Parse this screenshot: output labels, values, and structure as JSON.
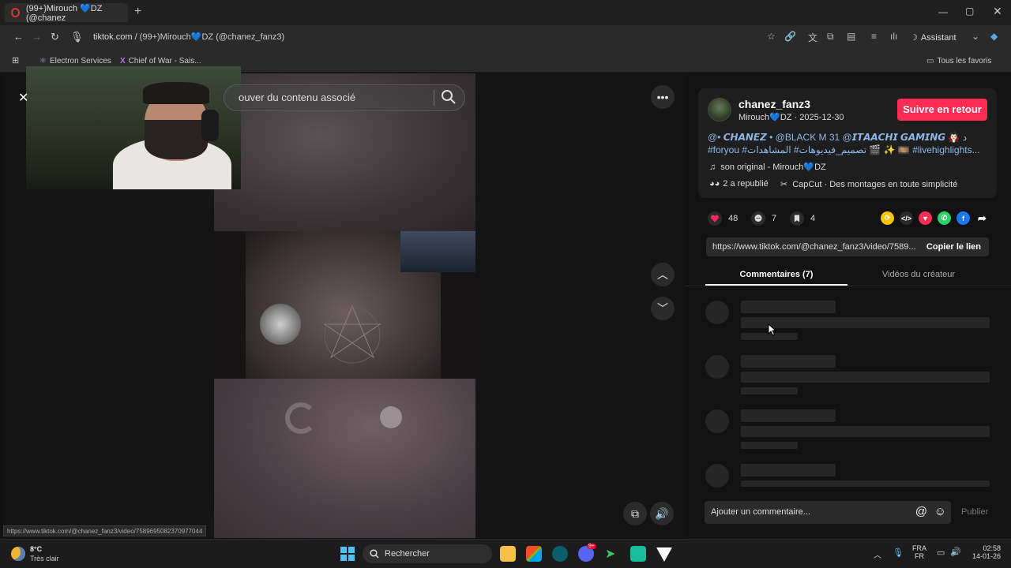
{
  "browser": {
    "tab_title": "(99+)Mirouch 💙DZ (@chanez",
    "url_host": "tiktok.com",
    "url_path": " / (99+)Mirouch💙DZ (@chanez_fanz3)",
    "assistant_label": "Assistant",
    "bookmarks": [
      "Electron Services",
      "Chief of War - Sais..."
    ],
    "all_bookmarks_label": "Tous les favoris"
  },
  "video": {
    "search_placeholder": "ouver du contenu associé"
  },
  "post": {
    "username": "chanez_fanz3",
    "display_name": "Mirouch💙DZ",
    "date": "2025-12-30",
    "follow_label": "Suivre en retour",
    "caption_line1": "@• 𝘾𝙃𝘼𝙉𝙀𝙕 • @BLACK M 31 @𝙄𝙏𝘼𝘼𝘾𝙃𝙄 𝙂𝘼𝙈𝙄𝙉𝙂 🧛🏻 د",
    "caption_line2": "#foryou #تصميم_فيديوهات# المشاهدات 🎬 ✨ 🎞️ #livehighlights...",
    "music": "son original - Mirouch💙DZ",
    "reposts": "2 a republié",
    "capcut": "CapCut · Des montages en toute simplicité",
    "likes": "48",
    "comments": "7",
    "saves": "4",
    "link": "https://www.tiktok.com/@chanez_fanz3/video/7589...",
    "copy_link_label": "Copier le lien",
    "tab_comments": "Commentaires (7)",
    "tab_videos": "Vidéos du créateur",
    "comment_placeholder": "Ajouter un commentaire...",
    "publish_label": "Publier"
  },
  "status_url": "https://www.tiktok.com/@chanez_fanz3/video/7589695082370977044",
  "taskbar": {
    "temperature": "8°C",
    "weather": "Très clair",
    "search_label": "Rechercher",
    "lang_top": "FRA",
    "lang_bottom": "FR",
    "time": "02:58",
    "date": "14-01-26",
    "discord_badge": "9+"
  },
  "colors": {
    "accent": "#fe2c55",
    "link_blue": "#8fb6e8"
  }
}
